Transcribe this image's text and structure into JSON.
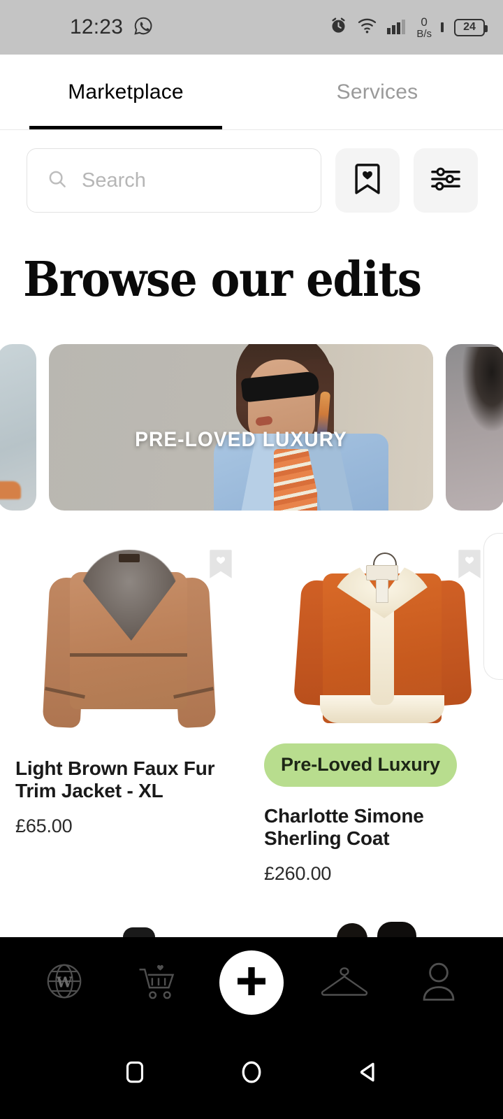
{
  "status_bar": {
    "time": "12:23",
    "whatsapp_icon": "whatsapp-icon",
    "alarm_icon": "alarm-icon",
    "wifi_icon": "wifi-icon",
    "signal_icon": "cellular-signal-icon",
    "net_speed_value": "0",
    "net_speed_unit": "B/s",
    "battery_level": "24"
  },
  "tabs": [
    {
      "label": "Marketplace",
      "active": true
    },
    {
      "label": "Services",
      "active": false
    }
  ],
  "search": {
    "placeholder": "Search",
    "value": "",
    "icon": "search-icon",
    "saved_button_icon": "bookmark-heart-icon",
    "filter_button_icon": "filter-sliders-icon"
  },
  "section": {
    "heading": "Browse our edits"
  },
  "edits_carousel": [
    {
      "label": "",
      "name": "edit-card-peek-left"
    },
    {
      "label": "PRE-LOVED LUXURY",
      "name": "edit-card-pre-loved-luxury"
    },
    {
      "label": "",
      "name": "edit-card-peek-right"
    }
  ],
  "products": [
    {
      "title": "Light Brown Faux Fur Trim Jacket - XL",
      "price": "£65.00",
      "badge": "",
      "save_icon": "bookmark-heart-icon"
    },
    {
      "title": "Charlotte Simone Sherling Coat",
      "price": "£260.00",
      "badge": "Pre-Loved Luxury",
      "save_icon": "bookmark-heart-icon"
    }
  ],
  "bottom_nav": [
    {
      "name": "nav-discover",
      "icon": "globe-w-icon"
    },
    {
      "name": "nav-cart",
      "icon": "cart-heart-icon"
    },
    {
      "name": "nav-add",
      "icon": "plus-icon"
    },
    {
      "name": "nav-wardrobe",
      "icon": "hanger-icon"
    },
    {
      "name": "nav-profile",
      "icon": "person-icon"
    }
  ],
  "android_nav": [
    {
      "name": "recents-button",
      "icon": "square-icon"
    },
    {
      "name": "home-button",
      "icon": "circle-icon"
    },
    {
      "name": "back-button",
      "icon": "triangle-back-icon"
    }
  ],
  "colors": {
    "status_bar_bg": "#c4c4c4",
    "accent_badge_bg": "#b8dd8e",
    "nav_bg": "#000000",
    "tab_active": "#000000",
    "tab_inactive": "#9a9a9a"
  }
}
